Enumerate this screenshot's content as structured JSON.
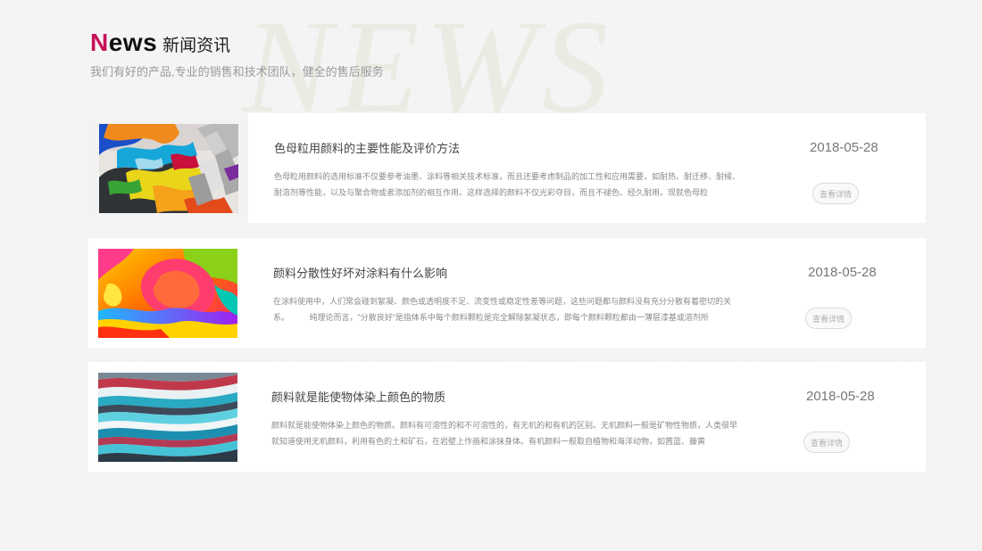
{
  "header": {
    "title_en_first": "N",
    "title_en_rest": "ews",
    "title_cn": "新闻资讯",
    "subtitle": "我们有好的产品,专业的销售和技术团队，健全的售后服务",
    "watermark": "NEWS"
  },
  "colors": {
    "accent": "#c8105a",
    "card_bg": "#ffffff",
    "page_bg": "#f6f6f6"
  },
  "news": [
    {
      "title": "色母粒用颜料的主要性能及评价方法",
      "desc": "色母粒用颜料的选用标准不仅要参考油墨、涂料等相关技术标准，而且还要考虑制品的加工性和应用需要，如耐热、耐迁移、耐候、耐溶剂等性能，以及与聚合物或者添加剂的相互作用。这样选择的颜料不仅光彩夺目，而且不褪色、经久耐用。现就色母粒",
      "date": "2018-05-28",
      "button": "查看详情",
      "image": "paint-tubes-image"
    },
    {
      "title": "颜料分散性好坏对涂料有什么影响",
      "desc": "在涂料使用中，人们常会碰到絮凝、颜色或透明度不足、流变性或稳定性差等问题，这些问题都与颜料没有充分分散有着密切的关系。　　　纯理论而言，\"分散良好\"是指体系中每个颜料颗粒是完全解除絮凝状态，即每个颜料颗粒都由一薄层漆基或溶剂所",
      "date": "2018-05-28",
      "button": "查看详情",
      "image": "colorful-paint-splash-image"
    },
    {
      "title": "颜料就是能使物体染上颜色的物质",
      "desc": "颜料就是能使物体染上颜色的物质。颜料有可溶性的和不可溶性的，有无机的和有机的区别。无机颜料一般是矿物性物质，人类很早就知道使用无机颜料，利用有色的土和矿石，在岩壁上作画和涂抹身体。有机颜料一般取自植物和海洋动物，如茜蓝、藤黄",
      "date": "2018-05-28",
      "button": "查看详情",
      "image": "marbled-paint-image"
    }
  ]
}
